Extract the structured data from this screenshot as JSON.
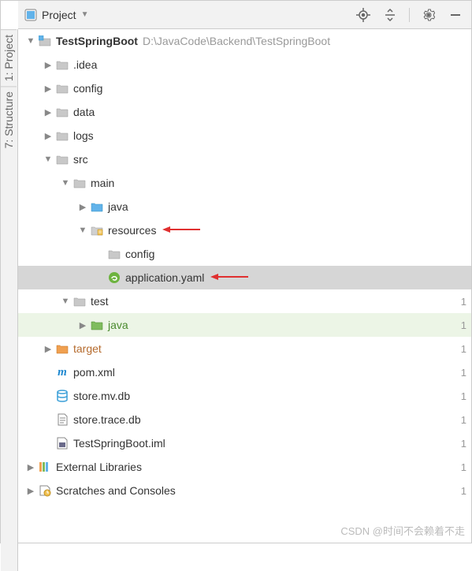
{
  "sidebar_tabs": {
    "project": "1: Project",
    "structure": "7: Structure"
  },
  "toolbar": {
    "title": "Project",
    "dropdown_indicator": "▼",
    "actions": {
      "locate": "locate",
      "collapse": "collapse",
      "settings": "settings",
      "hide": "hide"
    }
  },
  "tree": {
    "root": {
      "name": "TestSpringBoot",
      "path": "D:\\JavaCode\\Backend\\TestSpringBoot"
    },
    "idea": ".idea",
    "config": "config",
    "data": "data",
    "logs": "logs",
    "src": "src",
    "main": "main",
    "main_java": "java",
    "resources": "resources",
    "res_config": "config",
    "app_yaml": "application.yaml",
    "test": "test",
    "test_java": "java",
    "target": "target",
    "pom": "pom.xml",
    "store_mv": "store.mv.db",
    "store_trace": "store.trace.db",
    "iml": "TestSpringBoot.iml",
    "ext_libs": "External Libraries",
    "scratches": "Scratches and Consoles"
  },
  "gutter": {
    "app_yaml": "",
    "test": "1",
    "test_java": "1",
    "target": "1",
    "pom": "1",
    "store_mv": "1",
    "store_trace": "1",
    "iml": "1",
    "ext_libs": "1",
    "scratches": "1"
  },
  "watermark": "CSDN @时间不会赖着不走"
}
